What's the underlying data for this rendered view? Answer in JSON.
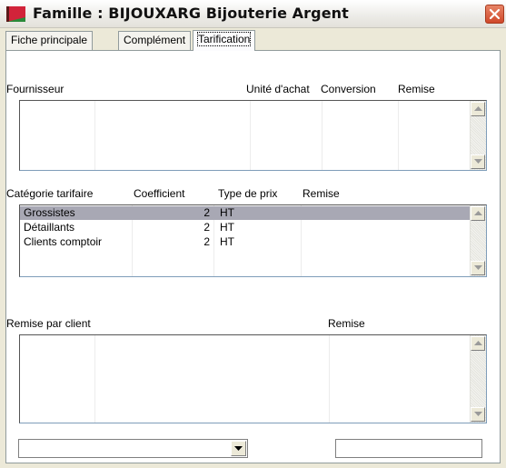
{
  "window": {
    "title": "Famille : BIJOUXARG Bijouterie Argent",
    "accent_colors": {
      "icon_red": "#d2233a",
      "icon_green": "#2a8a3a",
      "close": "#d0482a",
      "selection": "#a8a8b4"
    }
  },
  "tabs": [
    {
      "label": "Fiche principale",
      "active": false
    },
    {
      "label": "Complément",
      "active": false
    },
    {
      "label": "Tarification",
      "active": true
    }
  ],
  "fournisseurs": {
    "columns": [
      "Fournisseur",
      "Unité d'achat",
      "Conversion",
      "Remise"
    ],
    "rows": []
  },
  "categories": {
    "columns": [
      "Catégorie tarifaire",
      "Coefficient",
      "Type de prix",
      "Remise"
    ],
    "rows": [
      {
        "categorie": "Grossistes",
        "coefficient": "2",
        "type": "HT",
        "remise": ""
      },
      {
        "categorie": "Détaillants",
        "coefficient": "2",
        "type": "HT",
        "remise": ""
      },
      {
        "categorie": "Clients comptoir",
        "coefficient": "2",
        "type": "HT",
        "remise": ""
      }
    ]
  },
  "remises_client": {
    "columns": [
      "Remise par client",
      "Remise"
    ],
    "rows": []
  },
  "bottom": {
    "client_select_value": "",
    "remise_value": ""
  },
  "icons": {
    "app": "famille-icon",
    "close": "close-icon",
    "scroll_up": "arrow-up-icon",
    "scroll_down": "arrow-down-icon",
    "dropdown": "chevron-down-icon"
  }
}
